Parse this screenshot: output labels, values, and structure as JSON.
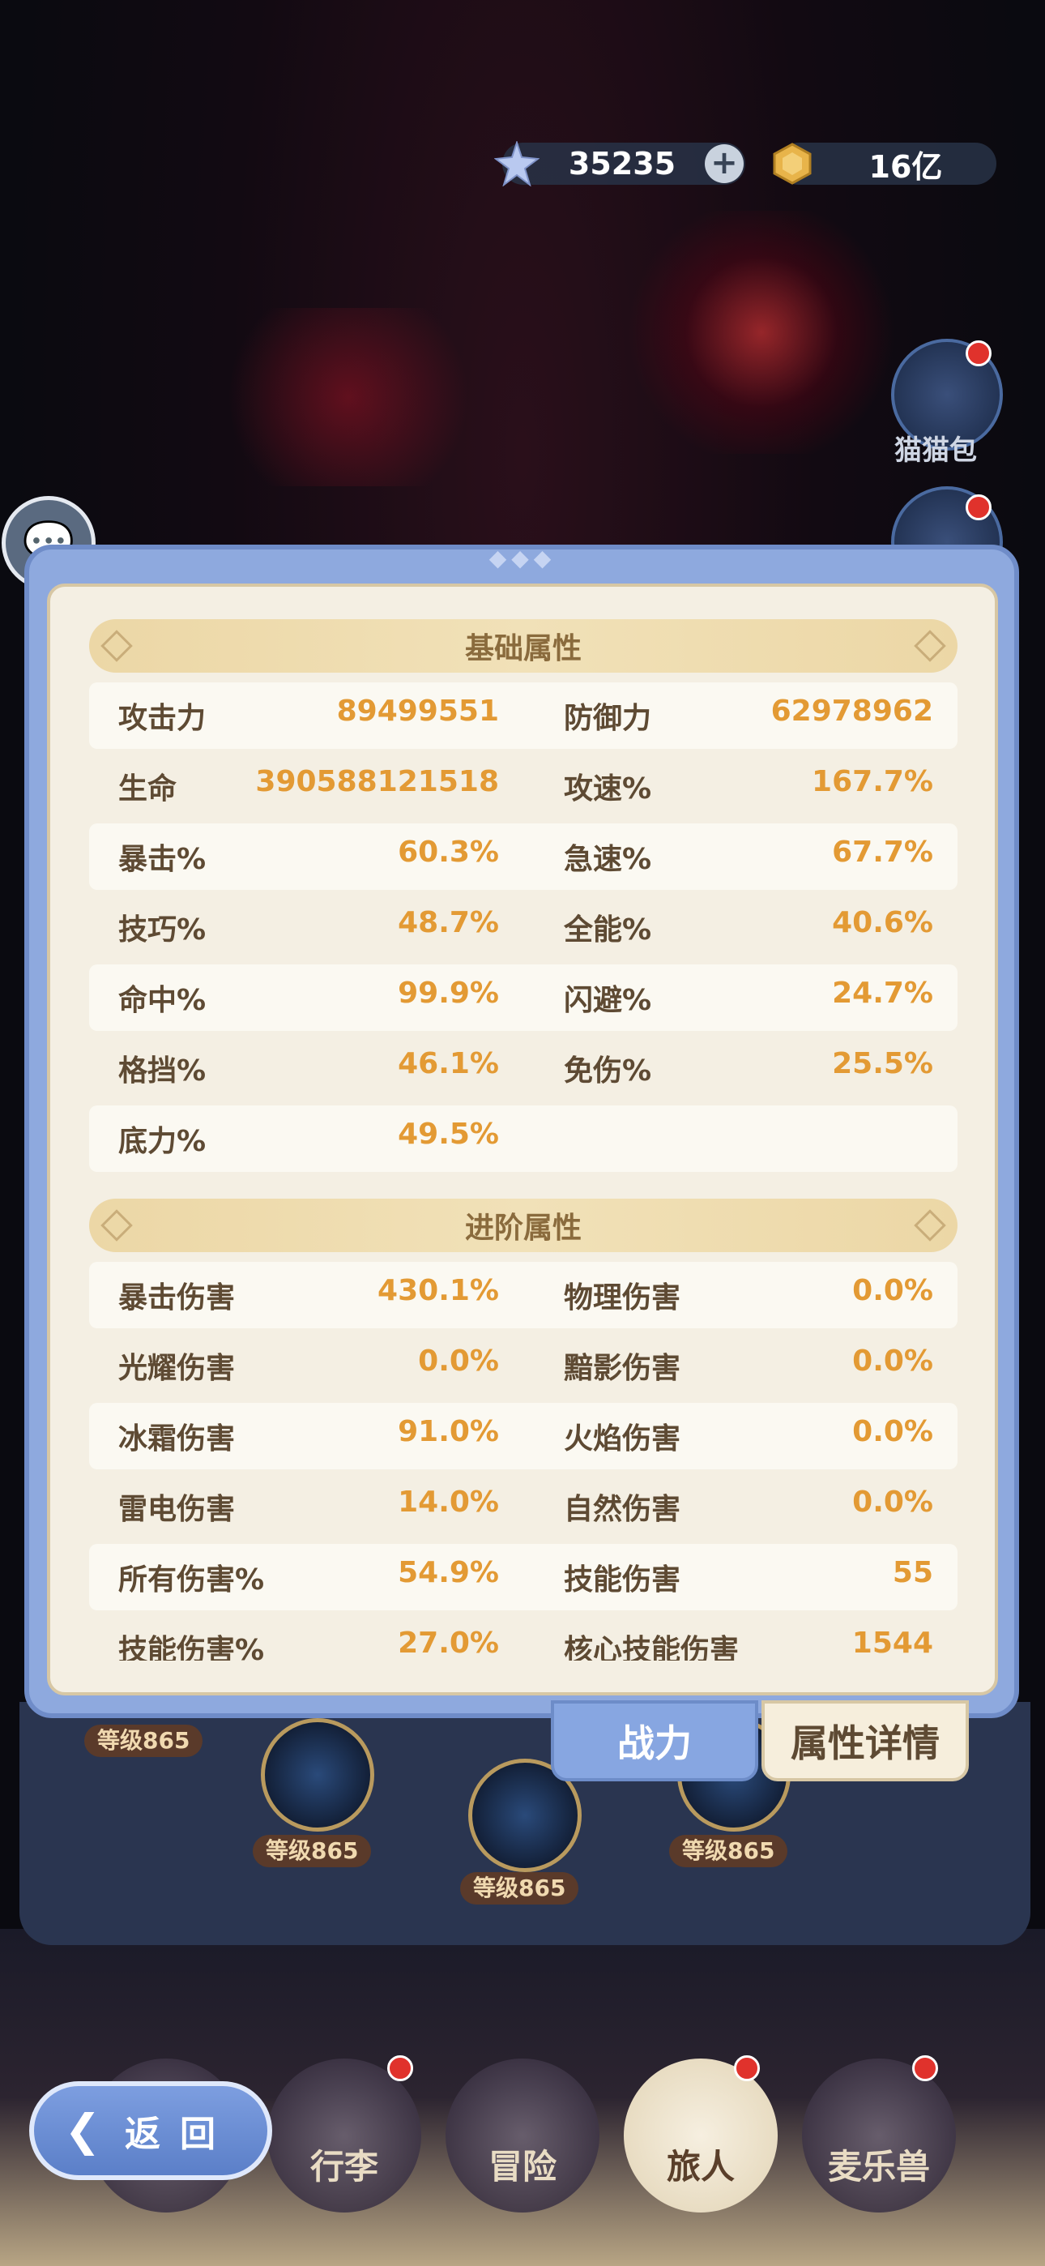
{
  "currency": {
    "gems": {
      "icon": "star-gem-icon",
      "value": "35235"
    },
    "gold": {
      "icon": "gold-coin-icon",
      "value": "16亿"
    }
  },
  "side": {
    "cat_bag_label": "猫猫包"
  },
  "panel": {
    "basic": {
      "title": "基础属性",
      "rows": [
        {
          "l_label": "攻击力",
          "l_value": "89499551",
          "r_label": "防御力",
          "r_value": "62978962"
        },
        {
          "l_label": "生命",
          "l_value": "390588121518",
          "r_label": "攻速%",
          "r_value": "167.7%"
        },
        {
          "l_label": "暴击%",
          "l_value": "60.3%",
          "r_label": "急速%",
          "r_value": "67.7%"
        },
        {
          "l_label": "技巧%",
          "l_value": "48.7%",
          "r_label": "全能%",
          "r_value": "40.6%"
        },
        {
          "l_label": "命中%",
          "l_value": "99.9%",
          "r_label": "闪避%",
          "r_value": "24.7%"
        },
        {
          "l_label": "格挡%",
          "l_value": "46.1%",
          "r_label": "免伤%",
          "r_value": "25.5%"
        },
        {
          "l_label": "底力%",
          "l_value": "49.5%",
          "r_label": "",
          "r_value": ""
        }
      ]
    },
    "advanced": {
      "title": "进阶属性",
      "rows": [
        {
          "l_label": "暴击伤害",
          "l_value": "430.1%",
          "r_label": "物理伤害",
          "r_value": "0.0%"
        },
        {
          "l_label": "光耀伤害",
          "l_value": "0.0%",
          "r_label": "黯影伤害",
          "r_value": "0.0%"
        },
        {
          "l_label": "冰霜伤害",
          "l_value": "91.0%",
          "r_label": "火焰伤害",
          "r_value": "0.0%"
        },
        {
          "l_label": "雷电伤害",
          "l_value": "14.0%",
          "r_label": "自然伤害",
          "r_value": "0.0%"
        },
        {
          "l_label": "所有伤害%",
          "l_value": "54.9%",
          "r_label": "技能伤害",
          "r_value": "55"
        },
        {
          "l_label": "技能伤害%",
          "l_value": "27.0%",
          "r_label": "核心技能伤害",
          "r_value": "1544"
        }
      ]
    }
  },
  "tabs": {
    "power": "战力",
    "detail": "属性详情"
  },
  "levels": [
    "等级865",
    "等级865",
    "等级865",
    "等级865"
  ],
  "nav": {
    "luggage": "行李",
    "adventure": "冒险",
    "traveler": "旅人",
    "mailebeast": "麦乐兽"
  },
  "back": "返回"
}
